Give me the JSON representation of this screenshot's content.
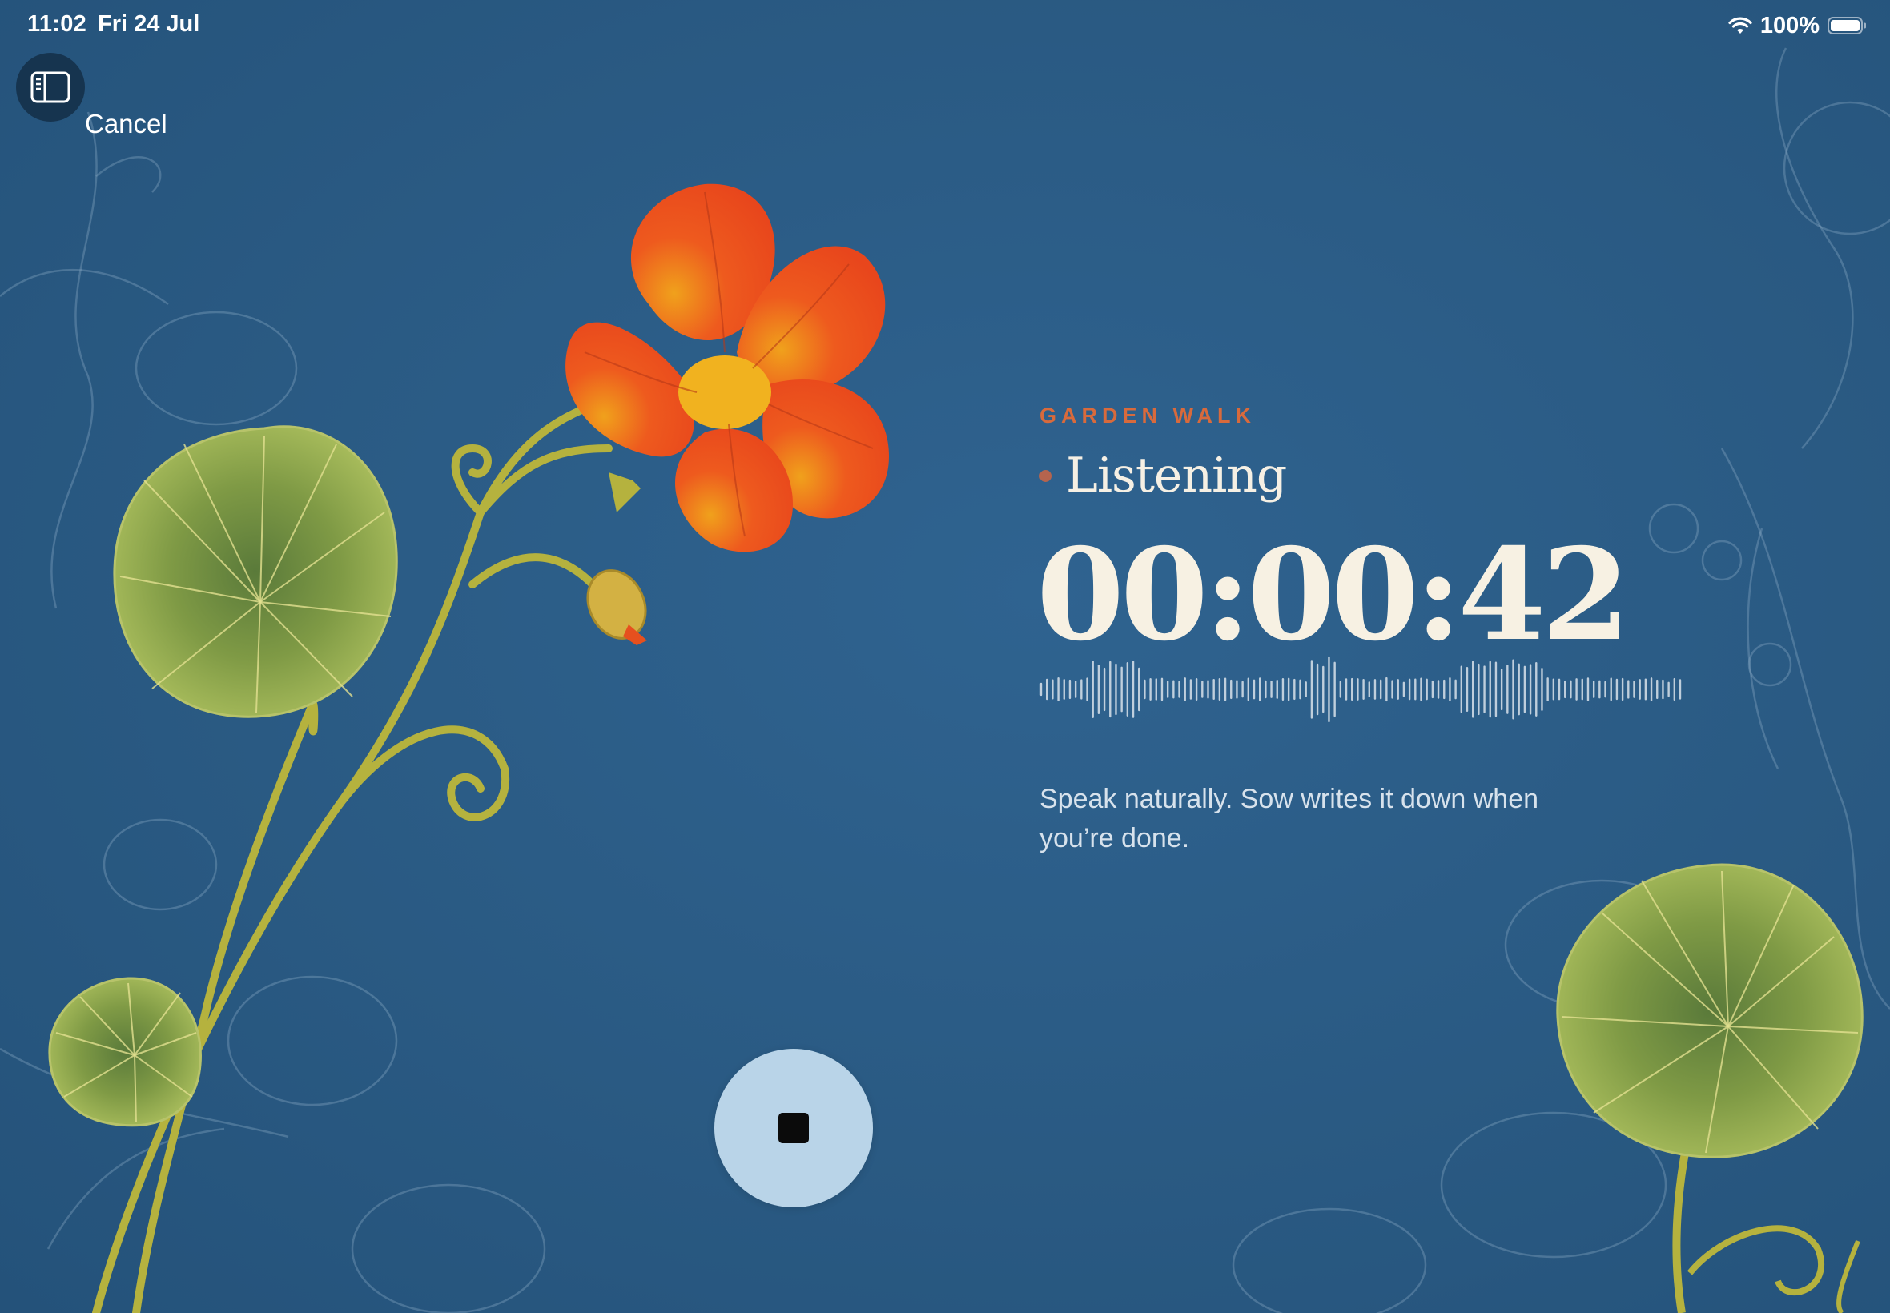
{
  "status_bar": {
    "time": "11:02",
    "date": "Fri 24 Jul",
    "battery_percent": "100%",
    "wifi_icon": "wifi-icon",
    "battery_icon": "battery-full-icon"
  },
  "nav": {
    "sidebar_icon": "sidebar-toggle-icon",
    "cancel_label": "Cancel"
  },
  "recording": {
    "section_label": "GARDEN WALK",
    "status": "Listening",
    "elapsed": "00:00:42",
    "hint": "Speak naturally. Sow writes it down when you’re done."
  },
  "controls": {
    "stop_icon": "stop-icon"
  },
  "colors": {
    "background": "#2b5b82",
    "accent": "#d86a3c",
    "recording_dot": "#b5644e",
    "text_primary": "#f7f1e3",
    "stop_button": "#b9d4e8"
  }
}
